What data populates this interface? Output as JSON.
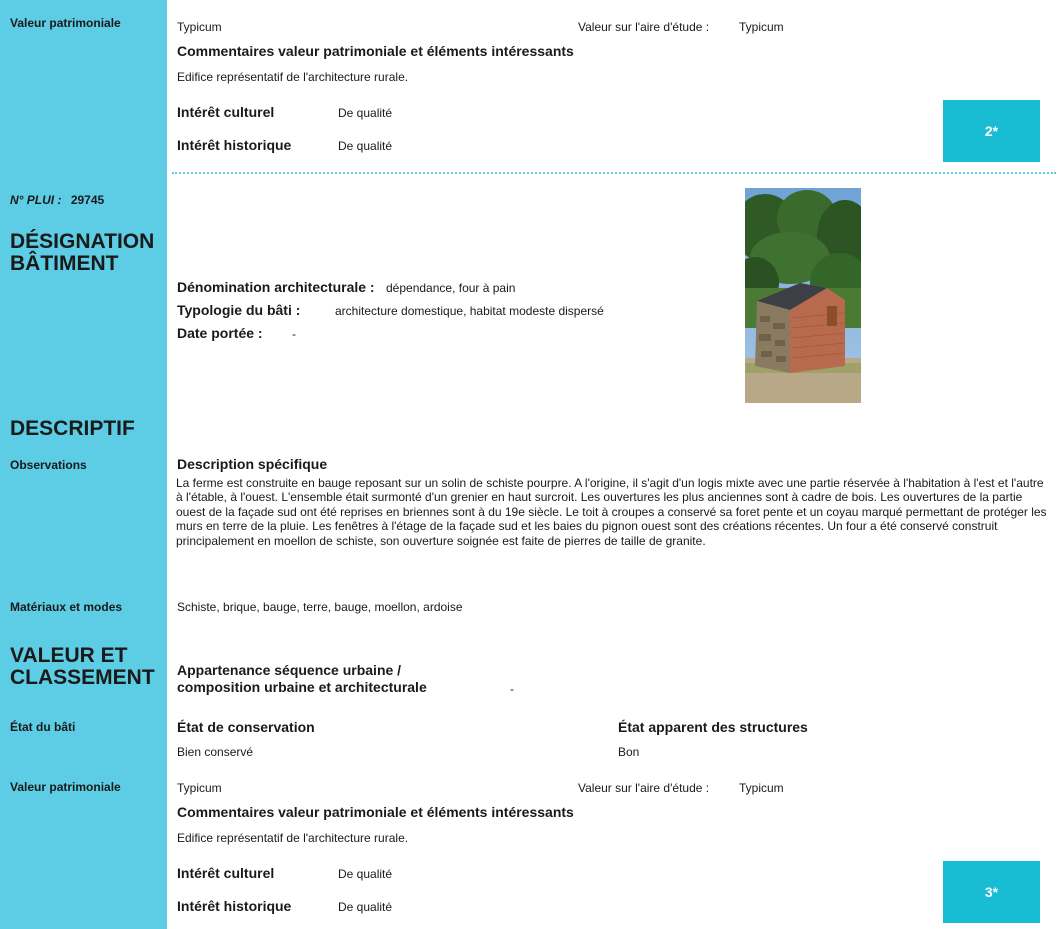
{
  "top": {
    "valeur_patrimoniale_label": "Valeur patrimoniale",
    "valeur_patrimoniale": "Typicum",
    "aire_label": "Valeur sur l'aire d'étude :",
    "aire_value": "Typicum",
    "commentaires_title": "Commentaires valeur patrimoniale et éléments intéressants",
    "commentaires_text": "Edifice représentatif de l'architecture rurale.",
    "interet_culturel_label": "Intérêt culturel",
    "interet_culturel_value": "De qualité",
    "interet_historique_label": "Intérêt historique",
    "interet_historique_value": "De qualité",
    "score": "2*"
  },
  "plui": {
    "label": "N° PLUI :",
    "value": "29745"
  },
  "designation": {
    "heading": "DÉSIGNATION BÂTIMENT",
    "denomination_label": "Dénomination architecturale :",
    "denomination_value": "dépendance, four à pain",
    "typologie_label": "Typologie du bâti :",
    "typologie_value": "architecture domestique, habitat modeste dispersé",
    "date_label": "Date portée :",
    "date_value": "-"
  },
  "descriptif": {
    "heading": "DESCRIPTIF",
    "observations_label": "Observations",
    "description_title": "Description spécifique",
    "description_text": "La ferme est construite en bauge reposant sur un solin de schiste pourpre. A l'origine, il s'agit d'un logis mixte avec une partie réservée à l'habitation à l'est et l'autre à l'étable, à l'ouest. L'ensemble était surmonté d'un grenier en haut surcroit. Les ouvertures les plus anciennes sont à cadre de bois. Les ouvertures de la partie ouest de la façade sud ont été reprises en briennes sont à du 19e siècle. Le toit à croupes a conservé sa foret pente et un coyau marqué permettant de protéger les murs en terre de la pluie. Les fenêtres à l'étage de la façade sud et les baies du pignon ouest sont des créations récentes. Un four a été conservé construit principalement en moellon de schiste, son ouverture soignée est faite de pierres de taille de granite.",
    "materiaux_label": "Matériaux et modes",
    "materiaux_value": "Schiste, brique, bauge, terre, bauge, moellon, ardoise"
  },
  "valeur": {
    "heading": "VALEUR ET CLASSEMENT",
    "appartenance_line1": "Appartenance séquence urbaine /",
    "appartenance_line2": "composition urbaine et architecturale",
    "appartenance_value": "-",
    "etat_label": "État du bâti",
    "etat_conservation_title": "État de conservation",
    "etat_conservation_value": "Bien conservé",
    "etat_structures_title": "État apparent des structures",
    "etat_structures_value": "Bon",
    "valeur_patrimoniale_label": "Valeur patrimoniale",
    "valeur_patrimoniale": "Typicum",
    "aire_label": "Valeur sur l'aire d'étude :",
    "aire_value": "Typicum",
    "commentaires_title": "Commentaires valeur patrimoniale et éléments intéressants",
    "commentaires_text": "Edifice représentatif de l'architecture rurale.",
    "interet_culturel_label": "Intérêt culturel",
    "interet_culturel_value": "De qualité",
    "interet_historique_label": "Intérêt historique",
    "interet_historique_value": "De qualité",
    "score": "3*"
  },
  "colors": {
    "sidebar": "#5ccde4",
    "score_box": "#19bdd3"
  }
}
